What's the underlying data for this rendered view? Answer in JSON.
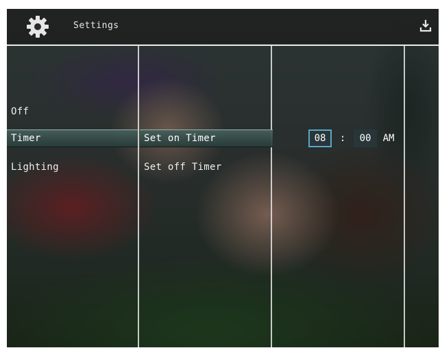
{
  "header": {
    "title": "Settings",
    "icon": "gear-icon",
    "right_icon": "download-icon"
  },
  "col1": {
    "items": [
      "Off",
      "Timer",
      "Lighting"
    ],
    "selected_index": 1
  },
  "col2": {
    "items": [
      "Set on Timer",
      "Set off Timer"
    ],
    "selected_index": 0
  },
  "time": {
    "hour": "08",
    "separator": ":",
    "minute": "00",
    "ampm": "AM"
  },
  "colors": {
    "accent": "#5aa8c8",
    "text": "#f0f0f0",
    "separator": "#e9e9e9"
  }
}
